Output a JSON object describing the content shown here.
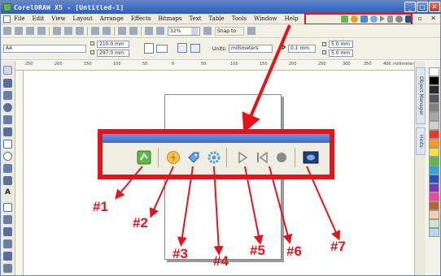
{
  "window": {
    "title": "CorelDRAW X5 - [Untitled-1]",
    "controls": [
      "_",
      "□",
      "✕"
    ]
  },
  "menubar": {
    "items": [
      "File",
      "Edit",
      "View",
      "Layout",
      "Arrange",
      "Effects",
      "Bitmaps",
      "Text",
      "Table",
      "Tools",
      "Window",
      "Help"
    ],
    "mdi_controls": "_ ▫ ✕"
  },
  "toolbar": {
    "zoom": "32%",
    "snap": "Snap to"
  },
  "property_bar": {
    "page_size": "A4",
    "width": "210.0 mm",
    "height": "297.0 mm",
    "units_label": "Units:",
    "units": "millimeters",
    "nudge": "0.1 mm",
    "dup_x": "5.0 mm",
    "dup_y": "5.0 mm"
  },
  "ruler": {
    "ticks": [
      "250",
      "200",
      "150",
      "100",
      "50",
      "0",
      "50",
      "100",
      "150",
      "200",
      "250",
      "300",
      "350",
      "400"
    ],
    "unit": "millimeters"
  },
  "dockers": {
    "tabs": [
      "Object Manager",
      "Hints"
    ]
  },
  "palette": {
    "colors": [
      "#ffffff",
      "#000000",
      "#2a2a2a",
      "#555555",
      "#808080",
      "#a8a8a8",
      "#d0d0d0",
      "#e23a2e",
      "#f39c2a",
      "#f6e03a",
      "#5fb84a",
      "#2aa7d6",
      "#2b4fb8",
      "#7a3ab8",
      "#e84aa0",
      "#b46a2a",
      "#f2d2b0",
      "#c8e6c8",
      "#b8d8f0"
    ]
  },
  "zoomed_toolbar": {
    "buttons": [
      {
        "name": "start-icon",
        "color": "#5fb84a"
      },
      {
        "name": "lightning-icon",
        "color": "#e8a020"
      },
      {
        "name": "tag-icon",
        "color": "#4a86d6"
      },
      {
        "name": "gear-icon",
        "color": "#5a9bd8"
      },
      {
        "name": "play-icon",
        "color": "#8a8a8a"
      },
      {
        "name": "rewind-icon",
        "color": "#8a8a8a"
      },
      {
        "name": "record-icon",
        "color": "#8a8a8a"
      },
      {
        "name": "screen-icon",
        "color": "#2b4f8f"
      }
    ]
  },
  "callouts": [
    "#1",
    "#2",
    "#3",
    "#4",
    "#5",
    "#6",
    "#7"
  ],
  "colors": {
    "highlight": "#e5141c"
  }
}
